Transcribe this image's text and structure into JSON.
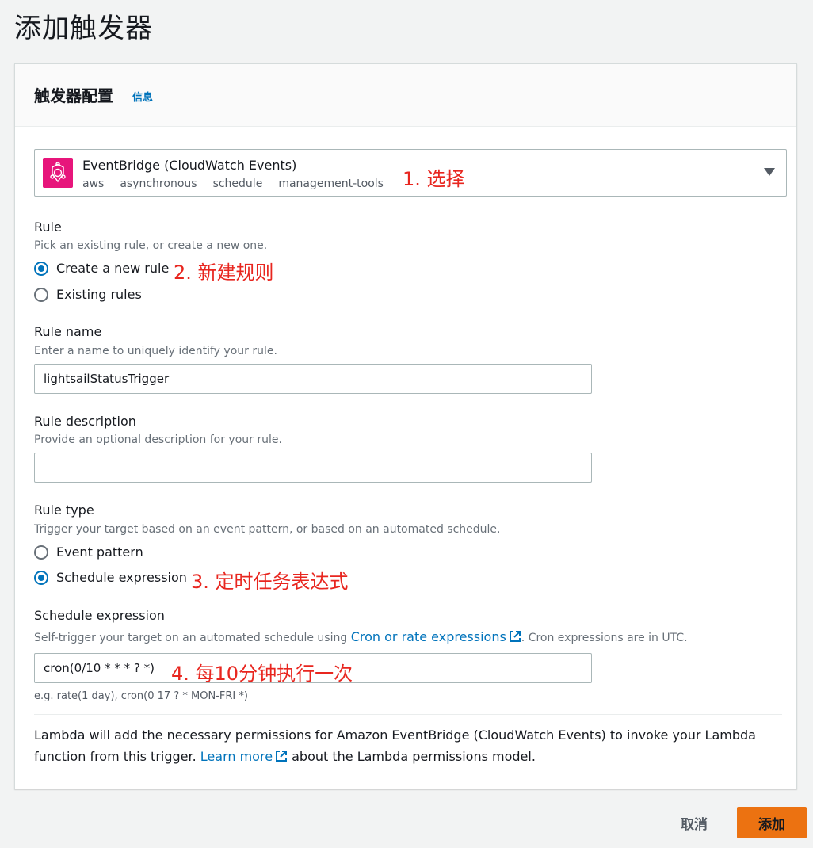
{
  "page": {
    "title": "添加触发器"
  },
  "panel": {
    "title": "触发器配置",
    "info_link": "信息"
  },
  "source": {
    "name": "EventBridge (CloudWatch Events)",
    "tags": [
      "aws",
      "asynchronous",
      "schedule",
      "management-tools"
    ],
    "icon": "eventbridge-icon",
    "icon_color": "#e7157b"
  },
  "annotations": {
    "a1": "1. 选择",
    "a2": "2. 新建规则",
    "a3": "3. 定时任务表达式",
    "a4": "4. 每10分钟执行一次"
  },
  "rule": {
    "label": "Rule",
    "description": "Pick an existing rule, or create a new one.",
    "options": [
      {
        "label": "Create a new rule",
        "checked": true
      },
      {
        "label": "Existing rules",
        "checked": false
      }
    ]
  },
  "rule_name": {
    "label": "Rule name",
    "description": "Enter a name to uniquely identify your rule.",
    "value": "lightsailStatusTrigger"
  },
  "rule_description": {
    "label": "Rule description",
    "description": "Provide an optional description for your rule.",
    "value": ""
  },
  "rule_type": {
    "label": "Rule type",
    "description": "Trigger your target based on an event pattern, or based on an automated schedule.",
    "options": [
      {
        "label": "Event pattern",
        "checked": false
      },
      {
        "label": "Schedule expression",
        "checked": true
      }
    ]
  },
  "schedule": {
    "label": "Schedule expression",
    "desc_prefix": "Self-trigger your target on an automated schedule using ",
    "desc_link": "Cron or rate expressions",
    "desc_suffix": ". Cron expressions are in UTC.",
    "value": "cron(0/10 * * * ? *)",
    "hint": "e.g. rate(1 day), cron(0 17 ? * MON-FRI *)"
  },
  "notice": {
    "text_before": "Lambda will add the necessary permissions for Amazon EventBridge (CloudWatch Events) to invoke your Lambda function from this trigger. ",
    "link": "Learn more",
    "text_after": " about the Lambda permissions model."
  },
  "actions": {
    "cancel": "取消",
    "add": "添加"
  },
  "colors": {
    "accent": "#0073bb",
    "primary_button": "#ec7211",
    "annotation": "#e8261f"
  }
}
